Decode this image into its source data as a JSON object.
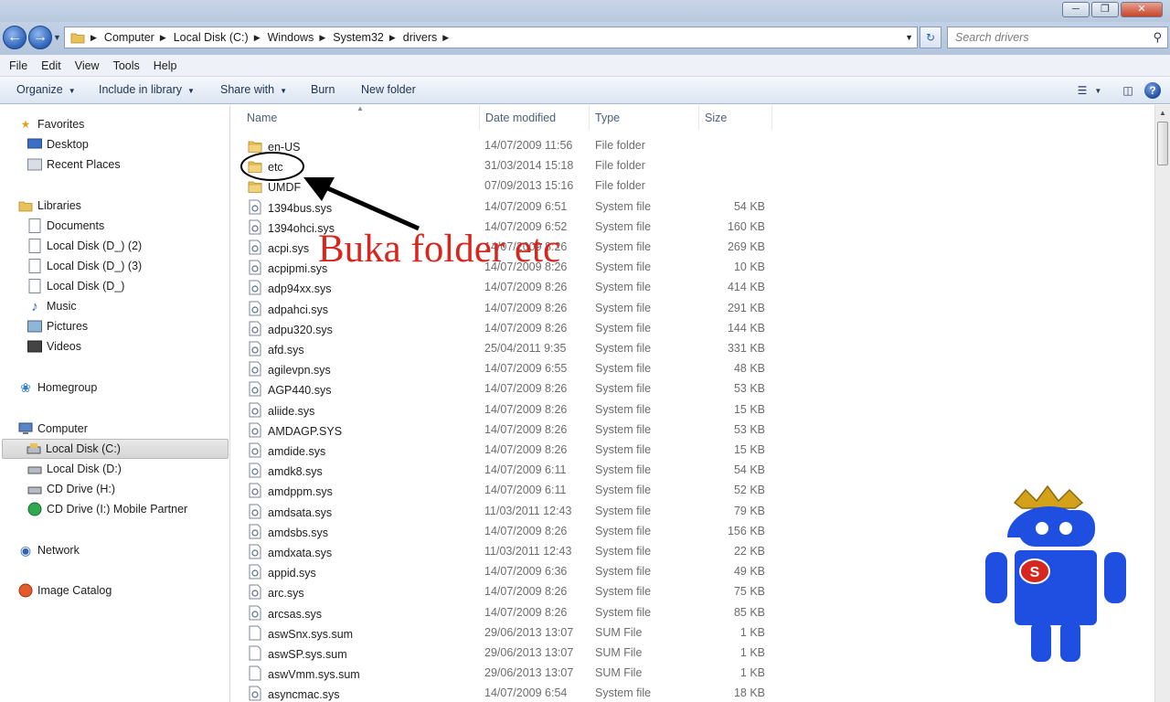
{
  "window": {
    "minimize_glyph": "─",
    "maximize_glyph": "❐",
    "close_glyph": "✕"
  },
  "address": {
    "breadcrumbs": [
      "Computer",
      "Local Disk (C:)",
      "Windows",
      "System32",
      "drivers"
    ],
    "search_placeholder": "Search drivers"
  },
  "menu": [
    "File",
    "Edit",
    "View",
    "Tools",
    "Help"
  ],
  "toolbar": {
    "organize": "Organize",
    "include_in_library": "Include in library",
    "share_with": "Share with",
    "burn": "Burn",
    "new_folder": "New folder"
  },
  "nav": {
    "favorites": "Favorites",
    "desktop": "Desktop",
    "recent_places": "Recent Places",
    "libraries": "Libraries",
    "documents": "Documents",
    "local_disk_d2": "Local Disk (D_) (2)",
    "local_disk_d3": "Local Disk (D_) (3)",
    "local_disk_d_": "Local Disk (D_)",
    "music": "Music",
    "pictures": "Pictures",
    "videos": "Videos",
    "homegroup": "Homegroup",
    "computer": "Computer",
    "local_disk_c": "Local Disk (C:)",
    "local_disk_d": "Local Disk (D:)",
    "cd_drive_h": "CD Drive (H:)",
    "cd_drive_i": "CD Drive (I:) Mobile Partner",
    "network": "Network",
    "image_catalog": "Image Catalog"
  },
  "columns": {
    "name": "Name",
    "date_modified": "Date modified",
    "type": "Type",
    "size": "Size"
  },
  "files": [
    {
      "name": "en-US",
      "date": "14/07/2009 11:56",
      "type": "File folder",
      "size": "",
      "kind": "folder"
    },
    {
      "name": "etc",
      "date": "31/03/2014 15:18",
      "type": "File folder",
      "size": "",
      "kind": "folder"
    },
    {
      "name": "UMDF",
      "date": "07/09/2013 15:16",
      "type": "File folder",
      "size": "",
      "kind": "folder"
    },
    {
      "name": "1394bus.sys",
      "date": "14/07/2009 6:51",
      "type": "System file",
      "size": "54 KB",
      "kind": "sys"
    },
    {
      "name": "1394ohci.sys",
      "date": "14/07/2009 6:52",
      "type": "System file",
      "size": "160 KB",
      "kind": "sys"
    },
    {
      "name": "acpi.sys",
      "date": "14/07/2009 8:26",
      "type": "System file",
      "size": "269 KB",
      "kind": "sys"
    },
    {
      "name": "acpipmi.sys",
      "date": "14/07/2009 8:26",
      "type": "System file",
      "size": "10 KB",
      "kind": "sys"
    },
    {
      "name": "adp94xx.sys",
      "date": "14/07/2009 8:26",
      "type": "System file",
      "size": "414 KB",
      "kind": "sys"
    },
    {
      "name": "adpahci.sys",
      "date": "14/07/2009 8:26",
      "type": "System file",
      "size": "291 KB",
      "kind": "sys"
    },
    {
      "name": "adpu320.sys",
      "date": "14/07/2009 8:26",
      "type": "System file",
      "size": "144 KB",
      "kind": "sys"
    },
    {
      "name": "afd.sys",
      "date": "25/04/2011 9:35",
      "type": "System file",
      "size": "331 KB",
      "kind": "sys"
    },
    {
      "name": "agilevpn.sys",
      "date": "14/07/2009 6:55",
      "type": "System file",
      "size": "48 KB",
      "kind": "sys"
    },
    {
      "name": "AGP440.sys",
      "date": "14/07/2009 8:26",
      "type": "System file",
      "size": "53 KB",
      "kind": "sys"
    },
    {
      "name": "aliide.sys",
      "date": "14/07/2009 8:26",
      "type": "System file",
      "size": "15 KB",
      "kind": "sys"
    },
    {
      "name": "AMDAGP.SYS",
      "date": "14/07/2009 8:26",
      "type": "System file",
      "size": "53 KB",
      "kind": "sys"
    },
    {
      "name": "amdide.sys",
      "date": "14/07/2009 8:26",
      "type": "System file",
      "size": "15 KB",
      "kind": "sys"
    },
    {
      "name": "amdk8.sys",
      "date": "14/07/2009 6:11",
      "type": "System file",
      "size": "54 KB",
      "kind": "sys"
    },
    {
      "name": "amdppm.sys",
      "date": "14/07/2009 6:11",
      "type": "System file",
      "size": "52 KB",
      "kind": "sys"
    },
    {
      "name": "amdsata.sys",
      "date": "11/03/2011 12:43",
      "type": "System file",
      "size": "79 KB",
      "kind": "sys"
    },
    {
      "name": "amdsbs.sys",
      "date": "14/07/2009 8:26",
      "type": "System file",
      "size": "156 KB",
      "kind": "sys"
    },
    {
      "name": "amdxata.sys",
      "date": "11/03/2011 12:43",
      "type": "System file",
      "size": "22 KB",
      "kind": "sys"
    },
    {
      "name": "appid.sys",
      "date": "14/07/2009 6:36",
      "type": "System file",
      "size": "49 KB",
      "kind": "sys"
    },
    {
      "name": "arc.sys",
      "date": "14/07/2009 8:26",
      "type": "System file",
      "size": "75 KB",
      "kind": "sys"
    },
    {
      "name": "arcsas.sys",
      "date": "14/07/2009 8:26",
      "type": "System file",
      "size": "85 KB",
      "kind": "sys"
    },
    {
      "name": "aswSnx.sys.sum",
      "date": "29/06/2013 13:07",
      "type": "SUM File",
      "size": "1 KB",
      "kind": "sum"
    },
    {
      "name": "aswSP.sys.sum",
      "date": "29/06/2013 13:07",
      "type": "SUM File",
      "size": "1 KB",
      "kind": "sum"
    },
    {
      "name": "aswVmm.sys.sum",
      "date": "29/06/2013 13:07",
      "type": "SUM File",
      "size": "1 KB",
      "kind": "sum"
    },
    {
      "name": "asyncmac.sys",
      "date": "14/07/2009 6:54",
      "type": "System file",
      "size": "18 KB",
      "kind": "sys"
    }
  ],
  "annotation": {
    "text": "Buka folder etc",
    "color": "#d7261e"
  },
  "mascot": {
    "badge_letter": "S",
    "body_color": "#1f4fe0",
    "crown_color": "#d4a21a"
  }
}
